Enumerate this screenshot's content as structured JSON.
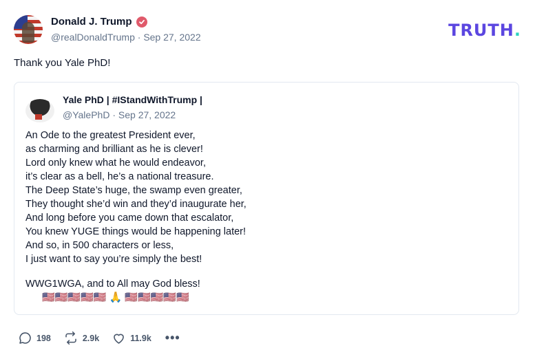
{
  "post": {
    "author_name": "Donald J. Trump",
    "handle": "@realDonaldTrump",
    "separator": "·",
    "date": "Sep 27, 2022",
    "text": "Thank you Yale PhD!"
  },
  "brand": {
    "logo_text": "TRUTH",
    "logo_dot": ".",
    "logo_color": "#5b46e0",
    "logo_dot_color": "#2dd4bf"
  },
  "quote": {
    "author_name": "Yale PhD | #IStandWithTrump |",
    "handle": "@YalePhD",
    "separator": "·",
    "date": "Sep 27, 2022",
    "lines": [
      "An Ode to the greatest President ever,",
      "as charming and brilliant as he is clever!",
      "Lord only knew what he would endeavor,",
      "it’s clear as a bell, he’s a national treasure.",
      "The Deep State’s huge, the swamp even greater,",
      "They thought she’d win and they’d inaugurate her,",
      "And long before you came down that escalator,",
      "You knew YUGE things would be happening later!",
      "And so, in 500 characters or less,",
      "I just want to say you’re simply the best!"
    ],
    "closing": "WWG1WGA, and to All may God bless!",
    "emoji_row": "🇺🇸🇺🇸🇺🇸🇺🇸🇺🇸 🙏 🇺🇸🇺🇸🇺🇸🇺🇸🇺🇸"
  },
  "actions": {
    "replies": "198",
    "retruths": "2.9k",
    "likes": "11.9k",
    "more": "•••"
  },
  "icons": {
    "verified": "verified-check-icon",
    "reply": "reply-bubble-icon",
    "retruth": "retruth-arrows-icon",
    "like": "heart-icon",
    "more": "more-dots-icon"
  },
  "colors": {
    "muted": "#64748b",
    "verified": "#e05a6b",
    "border": "#e2e8f0"
  }
}
